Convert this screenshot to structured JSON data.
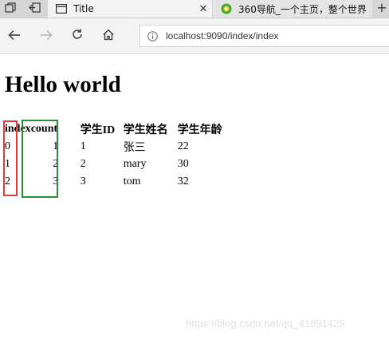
{
  "tabs": [
    {
      "title": "Title",
      "icon": "page-icon",
      "active": true,
      "close_label": "✕"
    },
    {
      "title": "360导航_一个主页，整个世界",
      "icon": "360-logo-icon",
      "active": false,
      "close_label": "✕"
    }
  ],
  "new_tab_label": "+",
  "address_bar": {
    "url": "localhost:9090/index/index",
    "icon": "info-icon"
  },
  "page": {
    "heading": "Hello world",
    "table": {
      "headers": [
        "index",
        "count",
        "学生ID",
        "学生姓名",
        "学生年龄"
      ],
      "rows": [
        [
          "0",
          "1",
          "1",
          "张三",
          "22"
        ],
        [
          "1",
          "2",
          "2",
          "mary",
          "30"
        ],
        [
          "2",
          "3",
          "3",
          "tom",
          "32"
        ]
      ]
    }
  },
  "highlight_colors": {
    "red_box": "#e03b3b",
    "green_box": "#2e8b3a"
  },
  "watermark": "https://blog.csdn.net/qq_41891425"
}
